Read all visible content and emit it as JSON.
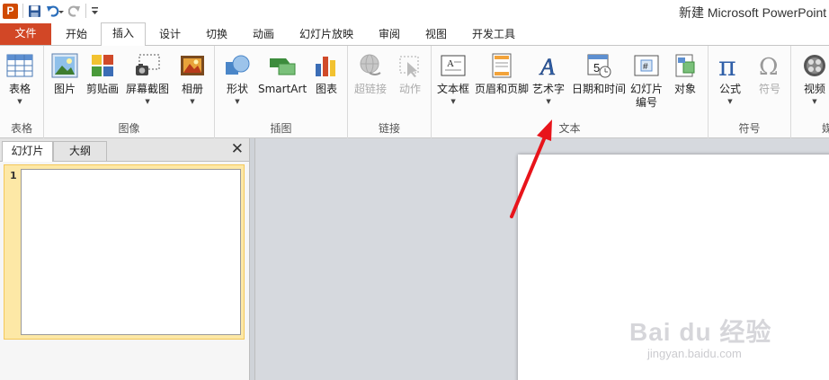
{
  "window": {
    "title": "新建 Microsoft PowerPoint"
  },
  "qat": {
    "logo_letter": "P"
  },
  "tabs": [
    {
      "label": "文件"
    },
    {
      "label": "开始"
    },
    {
      "label": "插入"
    },
    {
      "label": "设计"
    },
    {
      "label": "切换"
    },
    {
      "label": "动画"
    },
    {
      "label": "幻灯片放映"
    },
    {
      "label": "审阅"
    },
    {
      "label": "视图"
    },
    {
      "label": "开发工具"
    }
  ],
  "active_tab": "插入",
  "ribbon": {
    "groups": [
      {
        "label": "表格",
        "buttons": [
          {
            "label": "表格",
            "icon": "table-icon"
          }
        ]
      },
      {
        "label": "图像",
        "buttons": [
          {
            "label": "图片",
            "icon": "picture-icon"
          },
          {
            "label": "剪贴画",
            "icon": "clipart-icon"
          },
          {
            "label": "屏幕截图",
            "icon": "screenshot-icon"
          },
          {
            "label": "相册",
            "icon": "photo-album-icon"
          }
        ]
      },
      {
        "label": "插图",
        "buttons": [
          {
            "label": "形状",
            "icon": "shapes-icon"
          },
          {
            "label": "SmartArt",
            "icon": "smartart-icon"
          },
          {
            "label": "图表",
            "icon": "chart-icon"
          }
        ]
      },
      {
        "label": "链接",
        "buttons": [
          {
            "label": "超链接",
            "icon": "hyperlink-icon"
          },
          {
            "label": "动作",
            "icon": "action-icon"
          }
        ]
      },
      {
        "label": "文本",
        "buttons": [
          {
            "label": "文本框",
            "icon": "textbox-icon"
          },
          {
            "label": "页眉和页脚",
            "icon": "header-footer-icon"
          },
          {
            "label": "艺术字",
            "icon": "wordart-icon"
          },
          {
            "label": "日期和时间",
            "icon": "date-time-icon"
          },
          {
            "label": "幻灯片",
            "label2": "编号",
            "icon": "slide-number-icon"
          },
          {
            "label": "对象",
            "icon": "object-icon"
          }
        ]
      },
      {
        "label": "符号",
        "buttons": [
          {
            "label": "公式",
            "icon": "equation-icon"
          },
          {
            "label": "符号",
            "icon": "symbol-icon"
          }
        ]
      },
      {
        "label": "媒",
        "buttons": [
          {
            "label": "视频",
            "icon": "video-icon"
          }
        ]
      }
    ]
  },
  "left_pane": {
    "tabs": [
      {
        "label": "幻灯片"
      },
      {
        "label": "大纲"
      }
    ],
    "slides": [
      {
        "number": "1"
      }
    ]
  },
  "watermark": {
    "main": "Bai du 经验",
    "sub": "jingyan.baidu.com"
  },
  "colors": {
    "file_tab": "#d24726",
    "accent_red": "#e8141b",
    "slide_selected": "#fde8a6"
  }
}
